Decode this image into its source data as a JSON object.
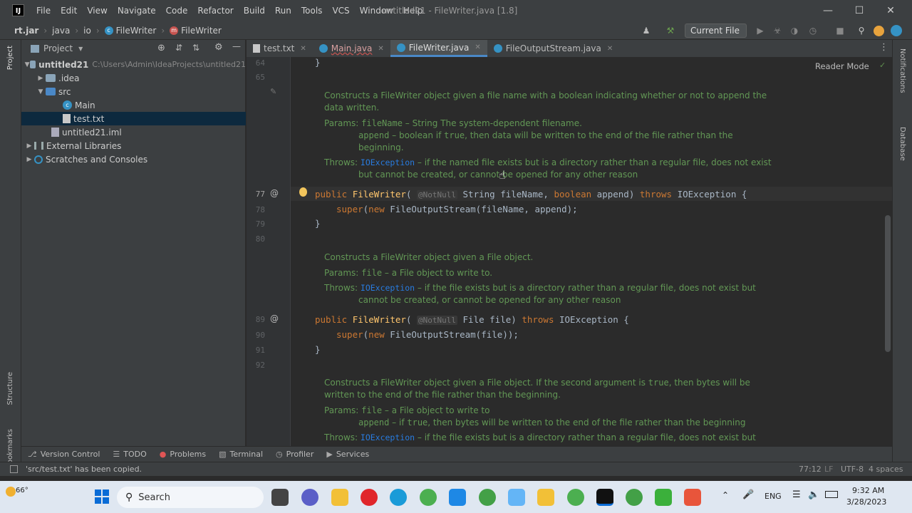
{
  "app": {
    "logo": "IJ",
    "window_title": "untitled21 - FileWriter.java [1.8]"
  },
  "menu": [
    "File",
    "Edit",
    "View",
    "Navigate",
    "Code",
    "Refactor",
    "Build",
    "Run",
    "Tools",
    "VCS",
    "Window",
    "Help"
  ],
  "breadcrumb": [
    "rt.jar",
    "java",
    "io",
    "FileWriter",
    "FileWriter"
  ],
  "toolbar": {
    "run_config": "Current File"
  },
  "project_panel": {
    "title": "Project",
    "tree": [
      {
        "label": "untitled21",
        "extra": "C:\\Users\\Admin\\IdeaProjects\\untitled21"
      },
      {
        "label": ".idea"
      },
      {
        "label": "src"
      },
      {
        "label": "Main"
      },
      {
        "label": "test.txt"
      },
      {
        "label": "untitled21.iml"
      },
      {
        "label": "External Libraries"
      },
      {
        "label": "Scratches and Consoles"
      }
    ]
  },
  "side_labels": {
    "project": "Project",
    "structure": "Structure",
    "bookmarks": "Bookmarks",
    "notifications": "Notifications",
    "database": "Database"
  },
  "tabs": [
    "test.txt",
    "Main.java",
    "FileWriter.java",
    "FileOutputStream.java"
  ],
  "editor": {
    "reader_mode": "Reader Mode",
    "line_numbers": {
      "l64": "64",
      "l65": "65",
      "l77": "77",
      "l78": "78",
      "l79": "79",
      "l80": "80",
      "l89": "89",
      "l90": "90",
      "l91": "91",
      "l92": "92"
    },
    "doc1": {
      "line1": "Constructs a FileWriter object given a file name with a boolean indicating whether or not to append the",
      "line2": "data written.",
      "params_label": "Params:",
      "p1_name": "fileName",
      "p1_desc": " – String The system-dependent filename.",
      "p2_name": "append",
      "p2_desc_a": " – boolean if ",
      "p2_true": "true",
      "p2_desc_b": ", then data will be written to the end of the file rather than the",
      "p2_desc_c": "beginning.",
      "throws_label": "Throws:",
      "exc": "IOException",
      "throws_a": " – if the named file exists but is a directory rather than a regular file, does not exist",
      "throws_b": "but cannot be created, or cannot be opened for any other reason"
    },
    "doc2": {
      "line1": "Constructs a FileWriter object given a File object.",
      "params_label": "Params:",
      "p1_name": "file",
      "p1_desc": " – a File object to write to.",
      "throws_label": "Throws:",
      "exc": "IOException",
      "throws_a": " – if the file exists but is a directory rather than a regular file, does not exist but",
      "throws_b": "cannot be created, or cannot be opened for any other reason"
    },
    "doc3": {
      "line1a": "Constructs a FileWriter object given a File object. If the second argument is ",
      "line1_true": "true",
      "line1b": ", then bytes will be",
      "line2": "written to the end of the file rather than the beginning.",
      "params_label": "Params:",
      "p1_name": "file",
      "p1_desc": " – a File object to write to",
      "p2_name": "append",
      "p2_desc_a": " – if ",
      "p2_true": "true",
      "p2_desc_b": ", then bytes will be written to the end of the file rather than the beginning",
      "throws_label": "Throws:",
      "exc": "IOException",
      "throws_a": " – if the file exists but is a directory rather than a regular file, does not exist but"
    },
    "code": {
      "l64": "}",
      "l77_public": "public",
      "l77_name": "FileWriter",
      "l77_open": "(",
      "l77_ann": "@NotNull",
      "l77_a": " String fileName, ",
      "l77_bool": "boolean",
      "l77_b": " append) ",
      "l77_throws": "throws",
      "l77_c": " IOException {",
      "l78_super": "super",
      "l78_a": "(",
      "l78_new": "new",
      "l78_b": " FileOutputStream(fileName, append);",
      "l79": "}",
      "l89_public": "public",
      "l89_name": "FileWriter",
      "l89_open": "(",
      "l89_ann": "@NotNull",
      "l89_a": " File file) ",
      "l89_throws": "throws",
      "l89_b": " IOException {",
      "l90_super": "super",
      "l90_a": "(",
      "l90_new": "new",
      "l90_b": " FileOutputStream(file));",
      "l91": "}"
    }
  },
  "bottom_tools": [
    "Version Control",
    "TODO",
    "Problems",
    "Terminal",
    "Profiler",
    "Services"
  ],
  "status": {
    "message": "'src/test.txt' has been copied.",
    "position": "77:12",
    "line_sep": "LF",
    "encoding": "UTF-8",
    "indent": "4 spaces"
  },
  "taskbar": {
    "weather": "66°",
    "search": "Search",
    "lang": "ENG",
    "time": "9:32 AM",
    "date": "3/28/2023"
  },
  "colors": {
    "accent": "#4a88c7",
    "doc_text": "#629755",
    "keyword": "#cc7832",
    "function": "#ffc66d"
  }
}
